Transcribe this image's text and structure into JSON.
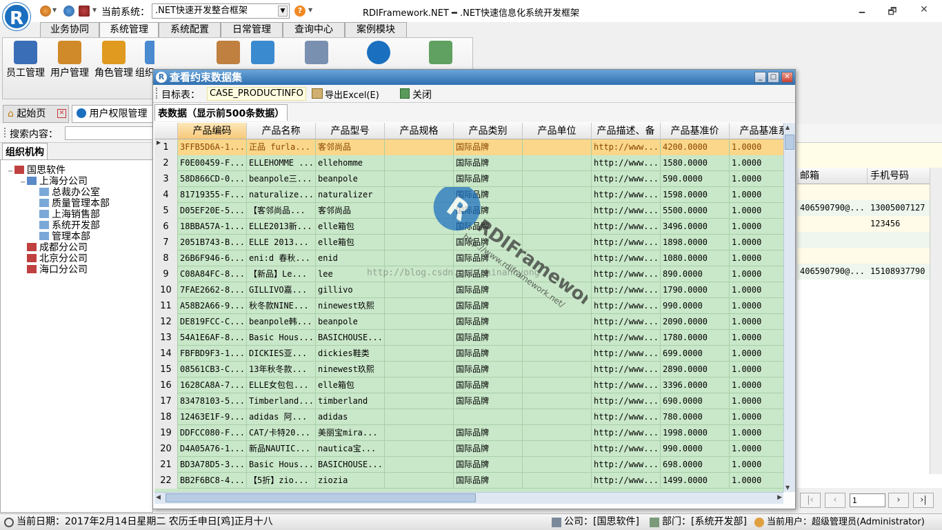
{
  "app": {
    "title": "RDIFramework.NET ━ .NET快速信息化系统开发框架",
    "logo_letter": "R",
    "current_system_label": "当前系统：",
    "current_system_value": ".NET快速开发整合框架",
    "help": "?",
    "win_minimize": "🗕",
    "win_restore": "🗗",
    "win_close": "✕"
  },
  "ribbon_tabs": [
    "业务协同",
    "系统管理",
    "系统配置",
    "日常管理",
    "查询中心",
    "案例模块"
  ],
  "ribbon_active": 1,
  "ribbon_buttons": [
    {
      "label": "员工管理",
      "icon": "employee-icon",
      "color": "#3a6fb8"
    },
    {
      "label": "用户管理",
      "icon": "user-icon",
      "color": "#d08a2a"
    },
    {
      "label": "角色管理",
      "icon": "role-icon",
      "color": "#e09a20"
    },
    {
      "label": "组织",
      "icon": "org-icon",
      "color": "#4a8ad0"
    },
    {
      "label": "",
      "icon": "document-icon",
      "color": "#c08040"
    },
    {
      "label": "",
      "icon": "module-icon",
      "color": "#3a8ad0"
    },
    {
      "label": "",
      "icon": "window-icon",
      "color": "#7a90b0"
    },
    {
      "label": "",
      "icon": "logo-icon",
      "color": "#1b6fbf"
    },
    {
      "label": "",
      "icon": "table-icon",
      "color": "#60a060"
    }
  ],
  "doc_tabs": [
    {
      "label": "起始页",
      "icon": "home-icon"
    },
    {
      "label": "用户权限管理",
      "icon": "rdi-icon"
    }
  ],
  "search": {
    "label": "搜索内容：",
    "placeholder": ""
  },
  "org": {
    "tab": "组织机构",
    "tree": [
      {
        "label": "国思软件",
        "level": 0,
        "expander": "−"
      },
      {
        "label": "上海分公司",
        "level": 1,
        "expander": "−"
      },
      {
        "label": "总裁办公室",
        "level": 2,
        "expander": ""
      },
      {
        "label": "质量管理本部",
        "level": 2,
        "expander": ""
      },
      {
        "label": "上海销售部",
        "level": 2,
        "expander": ""
      },
      {
        "label": "系统开发部",
        "level": 2,
        "expander": ""
      },
      {
        "label": "管理本部",
        "level": 2,
        "expander": ""
      },
      {
        "label": "成都分公司",
        "level": 1,
        "expander": ""
      },
      {
        "label": "北京分公司",
        "level": 1,
        "expander": ""
      },
      {
        "label": "海口分公司",
        "level": 1,
        "expander": ""
      }
    ]
  },
  "right_grid": {
    "headers": [
      "邮箱",
      "手机号码"
    ],
    "rows": [
      {
        "email": "",
        "phone": ""
      },
      {
        "email": "406590790@...",
        "phone": "13005007127"
      },
      {
        "email": "",
        "phone": "123456"
      },
      {
        "email": "",
        "phone": ""
      },
      {
        "email": "",
        "phone": ""
      },
      {
        "email": "406590790@...",
        "phone": "15108937790"
      }
    ],
    "page_value": "1"
  },
  "dialog": {
    "title": "查看约束数据集",
    "target_label": "目标表：",
    "target_value": "CASE_PRODUCTINFO",
    "export_label": "导出Excel(E)",
    "close_label": "关闭",
    "grid_caption": "表数据（显示前500条数据）",
    "columns": [
      "产品编码",
      "产品名称",
      "产品型号",
      "产品规格",
      "产品类别",
      "产品单位",
      "产品描述、备",
      "产品基准价",
      "产品基准系"
    ],
    "rows": [
      [
        "1",
        "3FFB5D6A-1...",
        "正品 furla...",
        "客邻尚品",
        "",
        "国际品牌",
        "",
        "http://www...",
        "4200.0000",
        "1.0000"
      ],
      [
        "2",
        "F0E00459-F...",
        "ELLEHOMME ...",
        "ellehomme",
        "",
        "国际品牌",
        "",
        "http://www...",
        "1580.0000",
        "1.0000"
      ],
      [
        "3",
        "58D866CD-0...",
        "beanpole三...",
        "beanpole",
        "",
        "国际品牌",
        "",
        "http://www...",
        "590.0000",
        "1.0000"
      ],
      [
        "4",
        "81719355-F...",
        "naturalize...",
        "naturalizer",
        "",
        "国际品牌",
        "",
        "http://www...",
        "1598.0000",
        "1.0000"
      ],
      [
        "5",
        "D05EF20E-5...",
        "【客邻尚品...",
        "客邻尚品",
        "",
        "国际品牌",
        "",
        "http://www...",
        "5500.0000",
        "1.0000"
      ],
      [
        "6",
        "18BBA57A-1...",
        "ELLE2013新...",
        "elle箱包",
        "",
        "国际品牌",
        "",
        "http://www...",
        "3496.0000",
        "1.0000"
      ],
      [
        "7",
        "2051B743-B...",
        "ELLE 2013...",
        "elle箱包",
        "",
        "国际品牌",
        "",
        "http://www...",
        "1898.0000",
        "1.0000"
      ],
      [
        "8",
        "26B6F946-6...",
        "eni:d 春秋...",
        "enid",
        "",
        "国际品牌",
        "",
        "http://www...",
        "1080.0000",
        "1.0000"
      ],
      [
        "9",
        "C08A84FC-8...",
        "【新品】Le...",
        "lee",
        "",
        "国际品牌",
        "",
        "http://www...",
        "890.0000",
        "1.0000"
      ],
      [
        "10",
        "7FAE2662-8...",
        "GILLIVO嘉...",
        "gillivo",
        "",
        "国际品牌",
        "",
        "http://www...",
        "1790.0000",
        "1.0000"
      ],
      [
        "11",
        "A58B2A66-9...",
        "秋冬款NINE...",
        "ninewest玖熙",
        "",
        "国际品牌",
        "",
        "http://www...",
        "990.0000",
        "1.0000"
      ],
      [
        "12",
        "DE819FCC-C...",
        "beanpole韩...",
        "beanpole",
        "",
        "国际品牌",
        "",
        "http://www...",
        "2090.0000",
        "1.0000"
      ],
      [
        "13",
        "54A1E6AF-8...",
        "Basic Hous...",
        "BASICHOUSE...",
        "",
        "国际品牌",
        "",
        "http://www...",
        "1780.0000",
        "1.0000"
      ],
      [
        "14",
        "FBFBD9F3-1...",
        "DICKIES亚...",
        "dickies鞋类",
        "",
        "国际品牌",
        "",
        "http://www...",
        "699.0000",
        "1.0000"
      ],
      [
        "15",
        "08561CB3-C...",
        "13年秋冬款...",
        "ninewest玖熙",
        "",
        "国际品牌",
        "",
        "http://www...",
        "2890.0000",
        "1.0000"
      ],
      [
        "16",
        "1628CA8A-7...",
        "ELLE女包包...",
        "elle箱包",
        "",
        "国际品牌",
        "",
        "http://www...",
        "3396.0000",
        "1.0000"
      ],
      [
        "17",
        "83478103-5...",
        "Timberland...",
        "timberland",
        "",
        "国际品牌",
        "",
        "http://www...",
        "690.0000",
        "1.0000"
      ],
      [
        "18",
        "12463E1F-9...",
        "adidas 阿...",
        "adidas",
        "",
        "",
        "",
        "http://www...",
        "780.0000",
        "1.0000"
      ],
      [
        "19",
        "DDFCC080-F...",
        "CAT/卡特20...",
        "美丽宝mira...",
        "",
        "国际品牌",
        "",
        "http://www...",
        "1998.0000",
        "1.0000"
      ],
      [
        "20",
        "D4A05A76-1...",
        "新品NAUTIC...",
        "nautica宝...",
        "",
        "国际品牌",
        "",
        "http://www...",
        "990.0000",
        "1.0000"
      ],
      [
        "21",
        "BD3A78D5-3...",
        "Basic Hous...",
        "BASICHOUSE...",
        "",
        "国际品牌",
        "",
        "http://www...",
        "698.0000",
        "1.0000"
      ],
      [
        "22",
        "BB2F6BC8-4...",
        "【5折】zio...",
        "ziozia",
        "",
        "国际品牌",
        "",
        "http://www...",
        "1499.0000",
        "1.0000"
      ]
    ]
  },
  "watermark": {
    "brand": "RDIFramework.NET",
    "url": "http://www.rdiframework.net/",
    "blog": "http://blog.csdn.net/chinahuyong"
  },
  "status": {
    "date": "当前日期：2017年2月14日星期二 农历壬申日[鸡]正月十八",
    "company": "公司：[国思软件]",
    "dept": "部门：[系统开发部]",
    "user": "当前用户：超级管理员(Administrator)"
  },
  "colors": {
    "accent": "#1b6fbf",
    "grid_bg": "#c9e7c9",
    "selected_row": "#fad78a",
    "title_blue": "#2f6fb0"
  }
}
